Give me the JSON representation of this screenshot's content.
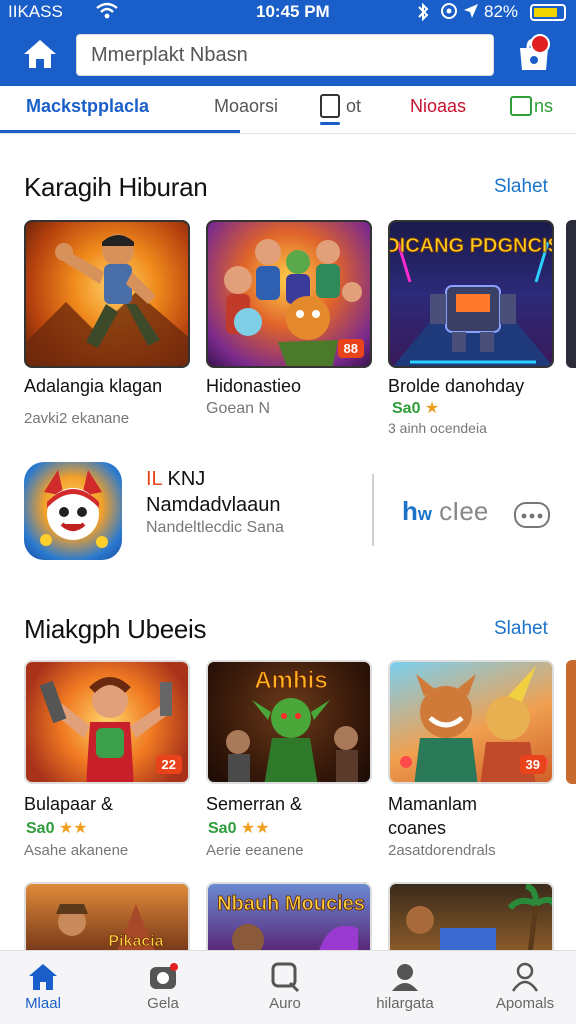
{
  "status_bar": {
    "carrier": "IIKASS",
    "time": "10:45 PM",
    "battery": "82%",
    "battery_level": 0.82
  },
  "header": {
    "search_value": "Mmerplakt Nbasn"
  },
  "tabs": [
    {
      "label": "Mackstpplacla"
    },
    {
      "label": "Moaorsi"
    },
    {
      "label": "ot"
    },
    {
      "label": "Nioaas"
    },
    {
      "label": "ns"
    }
  ],
  "section1": {
    "title": "Karagih Hiburan",
    "see_all": "Slahet",
    "cards": [
      {
        "name": "Adalangia klagan",
        "sub": "2avki2 ekanane"
      },
      {
        "name": "Hidonastieo",
        "sub": "Goean N",
        "badge": "88"
      },
      {
        "name": "Brolde danohday",
        "price": "Sa0",
        "rating_stars": "★",
        "sub": "3 ainh ocendeia",
        "art_title": "DICANG PDGNCIS"
      }
    ]
  },
  "featured": {
    "line1_accent": "IL",
    "line1_text": "KNJ",
    "line2": "Namdadvlaaun",
    "line3": "Nandeltlecdic Sana",
    "action_blue": "h",
    "action_blue2": "w",
    "action_text": "cIee"
  },
  "section2": {
    "title": "Miakgph Ubeeis",
    "see_all": "Slahet",
    "cards": [
      {
        "name": "Bulapaar &",
        "price": "Sa0",
        "rating_stars": "★★",
        "sub": "Asahe akanene",
        "badge": "22"
      },
      {
        "name": "Semerran &",
        "price": "Sa0",
        "rating_stars": "★★",
        "sub": "Aerie eeanene",
        "art_title": "Amhis"
      },
      {
        "name": "Mamanlam",
        "name2": "coanes",
        "sub": "2asatdorendrals",
        "badge": "39"
      }
    ]
  },
  "section3_art": [
    "Pikacia",
    "Nbauh Moucies"
  ],
  "bottom_nav": [
    {
      "label": "Mlaal",
      "icon": "home-icon",
      "active": true
    },
    {
      "label": "Gela",
      "icon": "games-icon",
      "active": false
    },
    {
      "label": "Auro",
      "icon": "search-icon",
      "active": false
    },
    {
      "label": "hilargata",
      "icon": "people-icon",
      "active": false
    },
    {
      "label": "Apomals",
      "icon": "person-icon",
      "active": false
    }
  ],
  "colors": {
    "brand": "#1a5fc9",
    "link": "#1a73c9",
    "price": "#2e9d3a",
    "star": "#f0a020",
    "alert": "#e02020"
  }
}
